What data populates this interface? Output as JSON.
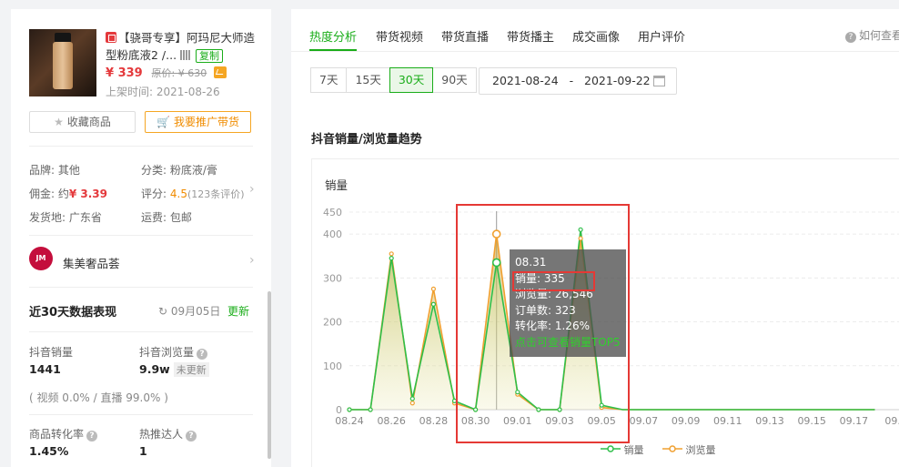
{
  "product": {
    "title": "【骁哥专享】阿玛尼大师造型粉底液2 /...",
    "copy_label": "复制",
    "price": "¥ 339",
    "original_price": "原价: ¥ 630",
    "listed_date": "上架时间: 2021-08-26"
  },
  "actions": {
    "favorite_label": "收藏商品",
    "promote_label": "我要推广带货"
  },
  "attributes": {
    "brand": "品牌: 其他",
    "category": "分类: 粉底液/膏",
    "commission_label": "佣金: 约",
    "commission_value": "¥ 3.39",
    "rating_label": "评分:",
    "rating_value": "4.5",
    "rating_count": "(123条评价)",
    "origin": "发货地: 广东省",
    "shipping": "运费: 包邮"
  },
  "shop": {
    "logo_text": "JM",
    "name": "集美奢品荟"
  },
  "stats": {
    "title": "近30天数据表现",
    "date": "09月05日",
    "update_label": "更新",
    "douyin_sales_label": "抖音销量",
    "douyin_sales_value": "1441",
    "douyin_views_label": "抖音浏览量",
    "douyin_views_value": "9.9w",
    "not_updated": "未更新",
    "channel_split": "( 视频 0.0% / 直播 99.0% )",
    "conversion_label": "商品转化率",
    "conversion_value": "1.45%",
    "hot_influencer_label": "热推达人",
    "hot_influencer_value": "1"
  },
  "tabs": [
    "热度分析",
    "带货视频",
    "带货直播",
    "带货播主",
    "成交画像",
    "用户评价"
  ],
  "help_text": "如何查看",
  "ranges": [
    "7天",
    "15天",
    "30天",
    "90天"
  ],
  "active_range": "30天",
  "date_range": "2021-08-24   -   2021-09-22",
  "trend_title": "抖音销量/浏览量趋势",
  "tooltip": {
    "date": "08.31",
    "sales": "销量: 335",
    "views": "浏览量: 26,546",
    "orders": "订单数: 323",
    "conversion": "转化率: 1.26%",
    "link": "点击可查看销量TOP5"
  },
  "colors": {
    "accent": "#1aad19",
    "sales_line": "#2fbf4a",
    "views_line": "#f0a030",
    "price": "#e4393c"
  },
  "chart_data": {
    "type": "line",
    "title": "销量",
    "ylim": [
      0,
      450
    ],
    "yticks": [
      0,
      100,
      200,
      300,
      400,
      450
    ],
    "x": [
      "08.24",
      "08.25",
      "08.26",
      "08.27",
      "08.28",
      "08.29",
      "08.30",
      "08.31",
      "09.01",
      "09.02",
      "09.03",
      "09.04",
      "09.05",
      "09.06",
      "09.07",
      "09.08",
      "09.09",
      "09.10",
      "09.11",
      "09.12",
      "09.13",
      "09.14",
      "09.15",
      "09.16",
      "09.17",
      "09.18"
    ],
    "xtick_labels": [
      "08.24",
      "08.26",
      "08.28",
      "08.30",
      "09.01",
      "09.03",
      "09.05",
      "09.07",
      "09.09",
      "09.11",
      "09.13",
      "09.15",
      "09.17",
      "09.1"
    ],
    "series": [
      {
        "name": "销量",
        "values": [
          0,
          0,
          345,
          25,
          240,
          20,
          0,
          335,
          40,
          0,
          0,
          410,
          10,
          0,
          0,
          0,
          0,
          0,
          0,
          0,
          0,
          0,
          0,
          0,
          0,
          0
        ]
      },
      {
        "name": "浏览量",
        "values": [
          0,
          0,
          355,
          15,
          275,
          15,
          0,
          400,
          35,
          0,
          0,
          390,
          5,
          0,
          0,
          0,
          0,
          0,
          0,
          0,
          0,
          0,
          0,
          0,
          0,
          0
        ]
      }
    ],
    "legend_position": "bottom-right",
    "grid": true
  }
}
